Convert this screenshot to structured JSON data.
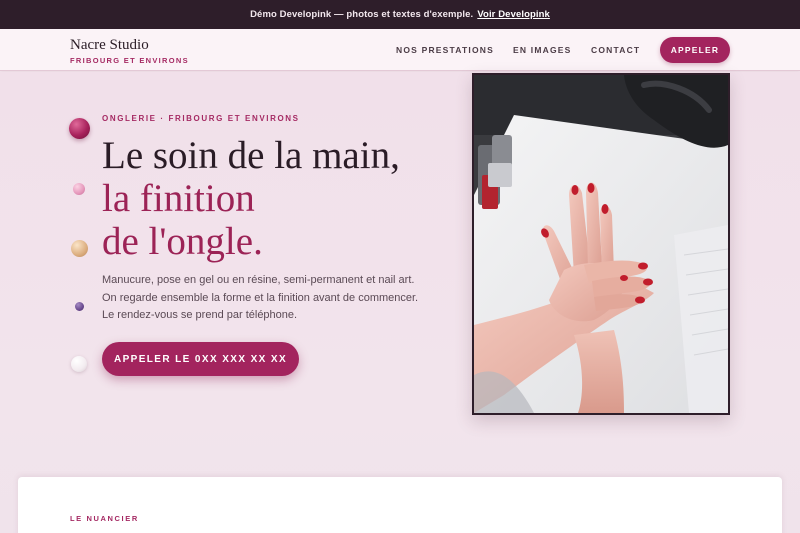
{
  "demo_banner": {
    "text": "Démo Developink — photos et textes d'exemple.",
    "link_label": "Voir Developink"
  },
  "header": {
    "brand_name": "Nacre Studio",
    "brand_tagline": "FRIBOURG ET ENVIRONS",
    "nav": [
      "NOS PRESTATIONS",
      "EN IMAGES",
      "CONTACT"
    ],
    "call_button": "APPELER"
  },
  "hero": {
    "eyebrow": "ONGLERIE · FRIBOURG ET ENVIRONS",
    "headline_line1": "Le soin de la main,",
    "headline_line2": "la finition",
    "headline_line3": "de l'ongle.",
    "intro": "Manucure, pose en gel ou en résine, semi-permanent et nail art. On regarde ensemble la forme et la finition avant de commencer. Le rendez-vous se prend par téléphone.",
    "cta": "APPELER LE 0XX XXX XX XX"
  },
  "next_section": {
    "label": "LE NUANCIER"
  },
  "colors": {
    "accent": "#a3245e",
    "dark": "#2e1e2a",
    "background": "#f4e6ee"
  }
}
